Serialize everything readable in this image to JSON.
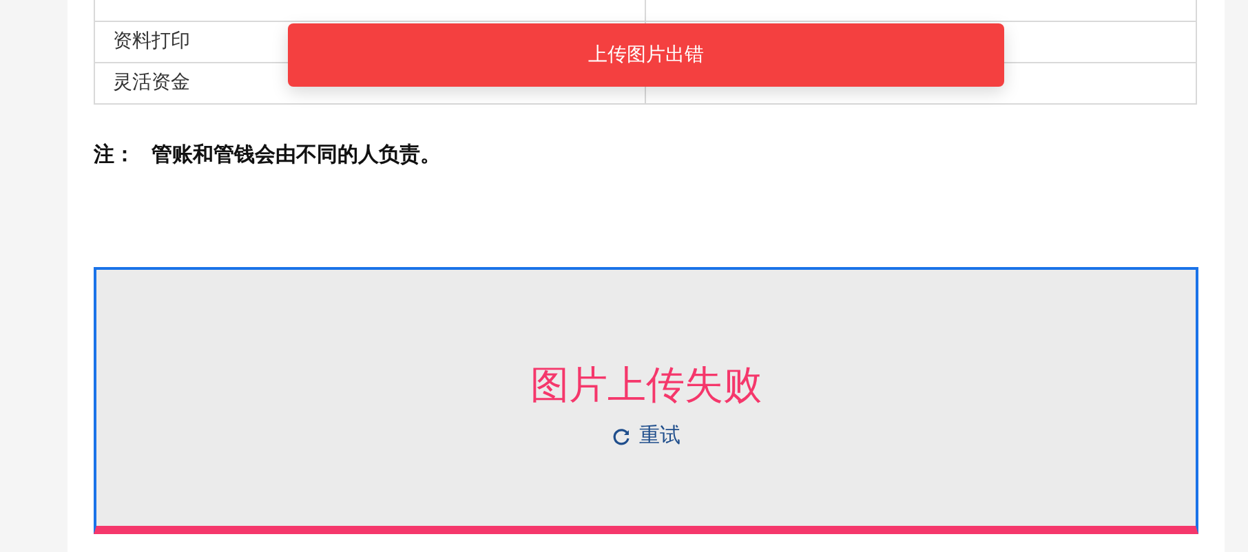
{
  "table": {
    "rows": [
      {
        "cells": [
          "资料打印",
          ""
        ]
      },
      {
        "cells": [
          "灵活资金",
          ""
        ]
      }
    ]
  },
  "note": {
    "label": "注：",
    "text": "管账和管钱会由不同的人负责。"
  },
  "upload": {
    "failed": true,
    "message": "图片上传失败",
    "retry": "重试"
  },
  "toast": {
    "message": "上传图片出错"
  }
}
